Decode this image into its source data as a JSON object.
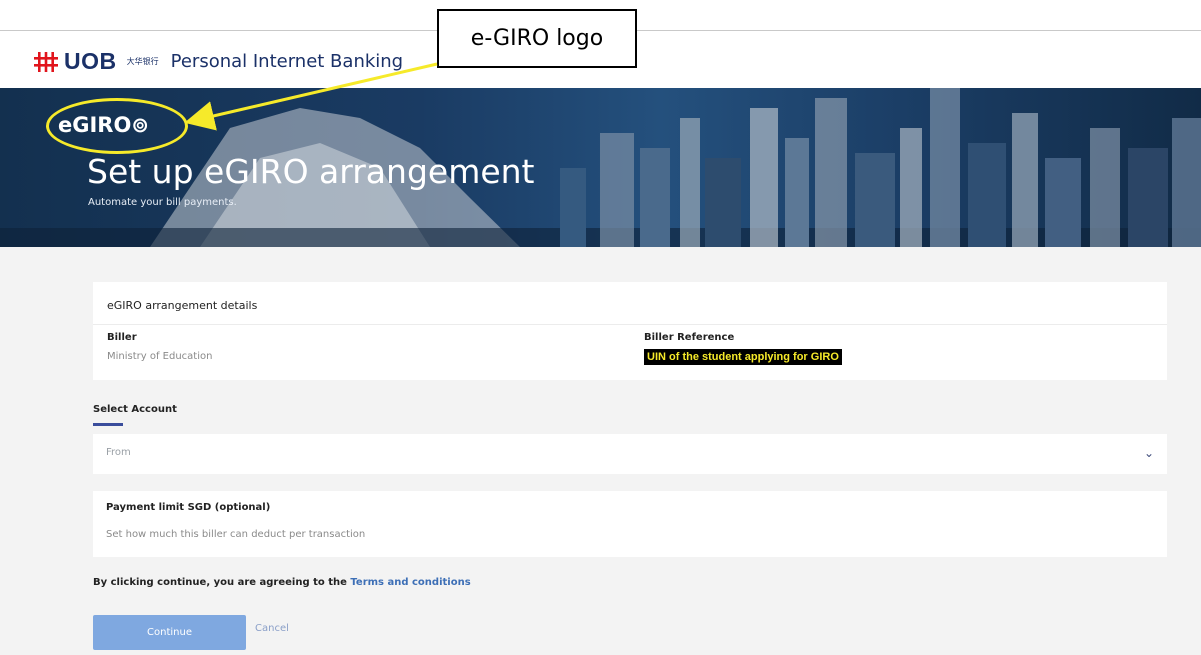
{
  "header": {
    "brand": "UOB",
    "brand_cn": "大华银行",
    "title": "Personal Internet Banking"
  },
  "callout": {
    "text": "e-GIRO logo"
  },
  "hero": {
    "logo": "eGIRO",
    "title": "Set up eGIRO arrangement",
    "subtitle": "Automate your bill payments."
  },
  "details": {
    "section_title": "eGIRO arrangement details",
    "biller_label": "Biller",
    "biller_value": "Ministry of Education",
    "reference_label": "Biller Reference",
    "reference_value": "UIN of the student applying for GIRO"
  },
  "select_account": {
    "label": "Select Account",
    "placeholder": "From"
  },
  "payment_limit": {
    "label": "Payment limit SGD (optional)",
    "description": "Set how much this biller can deduct per transaction"
  },
  "agreement": {
    "text": "By clicking continue, you are agreeing to the",
    "link": "Terms and conditions"
  },
  "actions": {
    "continue": "Continue",
    "cancel": "Cancel"
  },
  "colors": {
    "brand": "#1b3168",
    "accent": "#3a4d9c",
    "button": "#7fa8e0",
    "highlight": "#f6ea2a"
  }
}
